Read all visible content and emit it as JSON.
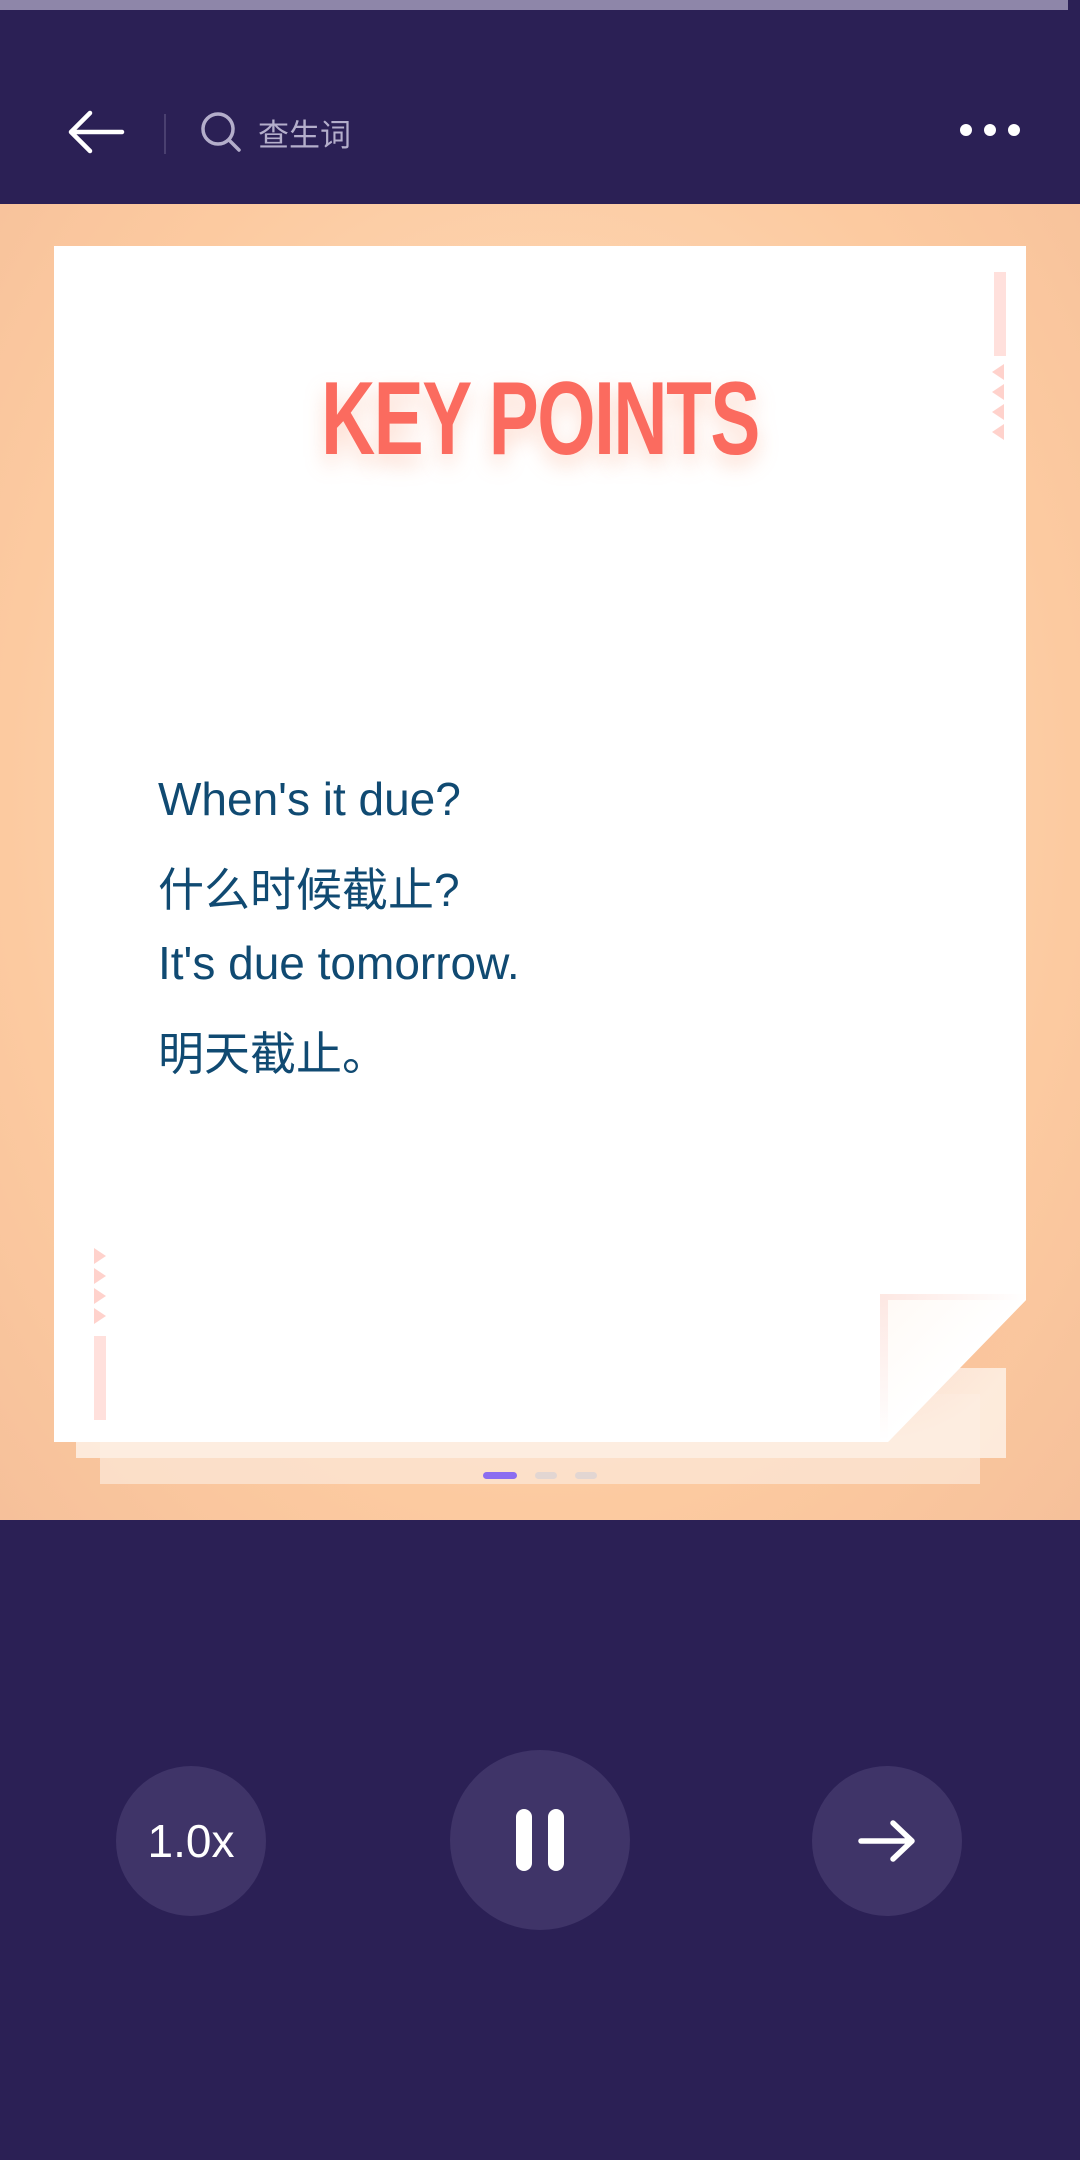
{
  "header": {
    "search_label": "查生词"
  },
  "card": {
    "title": "KEY POINTS",
    "lines": [
      "When's it due?",
      "什么时候截止?",
      "It's due tomorrow.",
      "明天截止。"
    ]
  },
  "pagination": {
    "current": 1,
    "total": 3
  },
  "controls": {
    "speed_label": "1.0x"
  },
  "colors": {
    "background": "#2b2055",
    "card_area": "#fccaa0",
    "title": "#fb6b5f",
    "phrase": "#104a72",
    "active_dot": "#8b6df0"
  },
  "icons": {
    "back": "back-arrow-icon",
    "search": "search-icon",
    "more": "more-dots-icon",
    "pause": "pause-icon",
    "next": "arrow-right-icon"
  }
}
